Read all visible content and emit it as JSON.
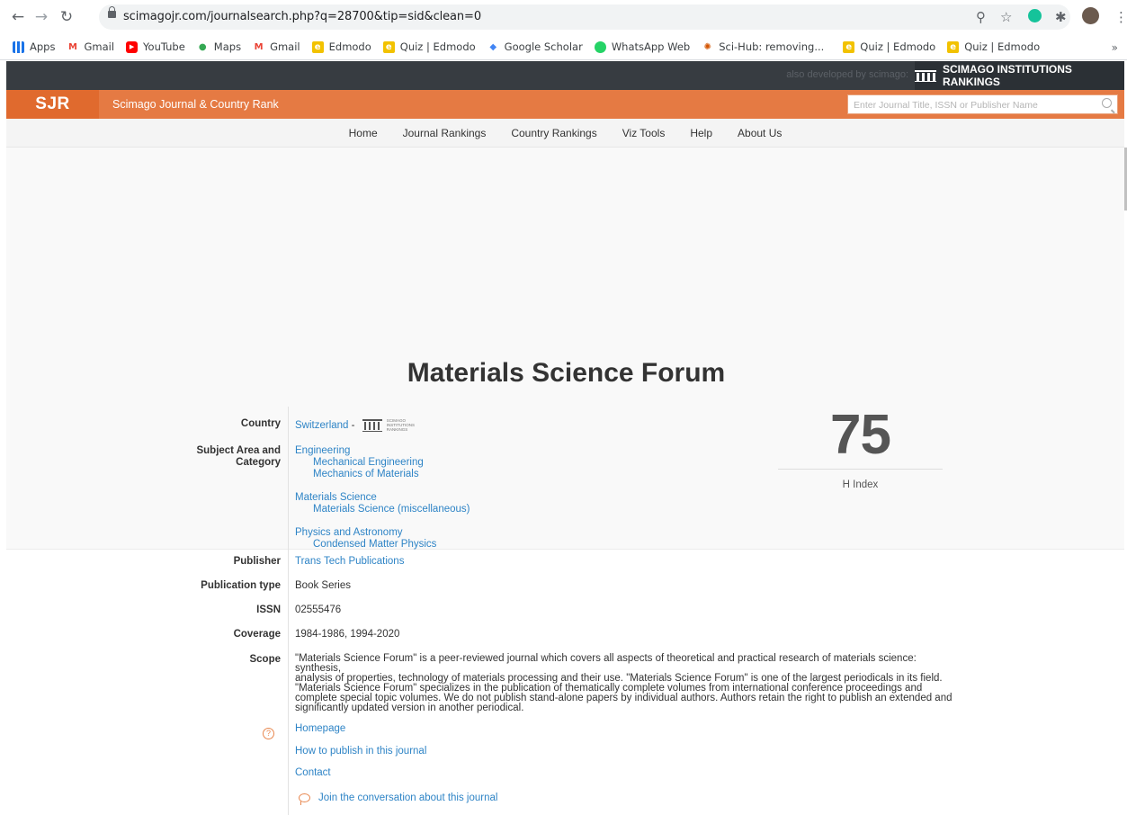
{
  "browser": {
    "url": "scimagojr.com/journalsearch.php?q=28700&tip=sid&clean=0",
    "bookmarks": [
      {
        "label": "Apps",
        "icon": "apps-grid-icon",
        "color": "#1a73e8"
      },
      {
        "label": "Gmail",
        "icon": "gmail-icon",
        "color": "#ea4335"
      },
      {
        "label": "YouTube",
        "icon": "youtube-icon",
        "color": "#ff0000"
      },
      {
        "label": "Maps",
        "icon": "maps-pin-icon",
        "color": "#34a853"
      },
      {
        "label": "Gmail",
        "icon": "gmail-icon",
        "color": "#ea4335"
      },
      {
        "label": "Edmodo",
        "icon": "edmodo-icon",
        "color": "#f2c200"
      },
      {
        "label": "Quiz | Edmodo",
        "icon": "edmodo-icon",
        "color": "#f2c200"
      },
      {
        "label": "Google Scholar",
        "icon": "scholar-icon",
        "color": "#4285f4"
      },
      {
        "label": "WhatsApp Web",
        "icon": "whatsapp-icon",
        "color": "#25d366"
      },
      {
        "label": "Sci-Hub: removing...",
        "icon": "scihub-icon",
        "color": "#d35400"
      },
      {
        "label": "Quiz | Edmodo",
        "icon": "edmodo-icon",
        "color": "#f2c200"
      },
      {
        "label": "Quiz | Edmodo",
        "icon": "edmodo-icon",
        "color": "#f2c200"
      }
    ],
    "more_label": "»"
  },
  "topbar": {
    "also_developed": "also developed by scimago:",
    "sir_label": "SCIMAGO INSTITUTIONS RANKINGS"
  },
  "header": {
    "logo": "SJR",
    "site_title": "Scimago Journal & Country Rank",
    "search_placeholder": "Enter Journal Title, ISSN or Publisher Name"
  },
  "nav": [
    "Home",
    "Journal Rankings",
    "Country Rankings",
    "Viz Tools",
    "Help",
    "About Us"
  ],
  "journal": {
    "title": "Materials Science Forum",
    "labels": {
      "country": "Country",
      "subject_1": "Subject Area and",
      "subject_2": "Category",
      "publisher": "Publisher",
      "publication_type": "Publication type",
      "issn": "ISSN",
      "coverage": "Coverage",
      "scope": "Scope"
    },
    "country": "Switzerland",
    "country_sep": "-",
    "sir_mini_text": "SCIMAGO INSTITUTIONS RANKINGS",
    "subjects": [
      {
        "area": "Engineering",
        "categories": [
          "Mechanical Engineering",
          "Mechanics of Materials"
        ]
      },
      {
        "area": "Materials Science",
        "categories": [
          "Materials Science (miscellaneous)"
        ]
      },
      {
        "area": "Physics and Astronomy",
        "categories": [
          "Condensed Matter Physics"
        ]
      }
    ],
    "h_index": "75",
    "h_index_label": "H Index",
    "publisher": "Trans Tech Publications",
    "publication_type": "Book Series",
    "issn": "02555476",
    "coverage": "1984-1986, 1994-2020",
    "scope_lines": [
      "\"Materials Science Forum\" is a peer-reviewed journal which covers all aspects of theoretical and practical research of materials science: synthesis,",
      "analysis of properties, technology of materials processing and their use. \"Materials Science Forum\" is one of the largest periodicals in its field.",
      "\"Materials Science Forum\" specializes in the publication of thematically complete volumes from international conference proceedings and",
      "complete special topic volumes. We do not publish stand-alone papers by individual authors. Authors retain the right to publish an extended and",
      "significantly updated version in another periodical."
    ],
    "links": {
      "homepage": "Homepage",
      "how_to_publish": "How to publish in this journal",
      "contact": "Contact",
      "conversation": "Join the conversation about this journal"
    }
  }
}
